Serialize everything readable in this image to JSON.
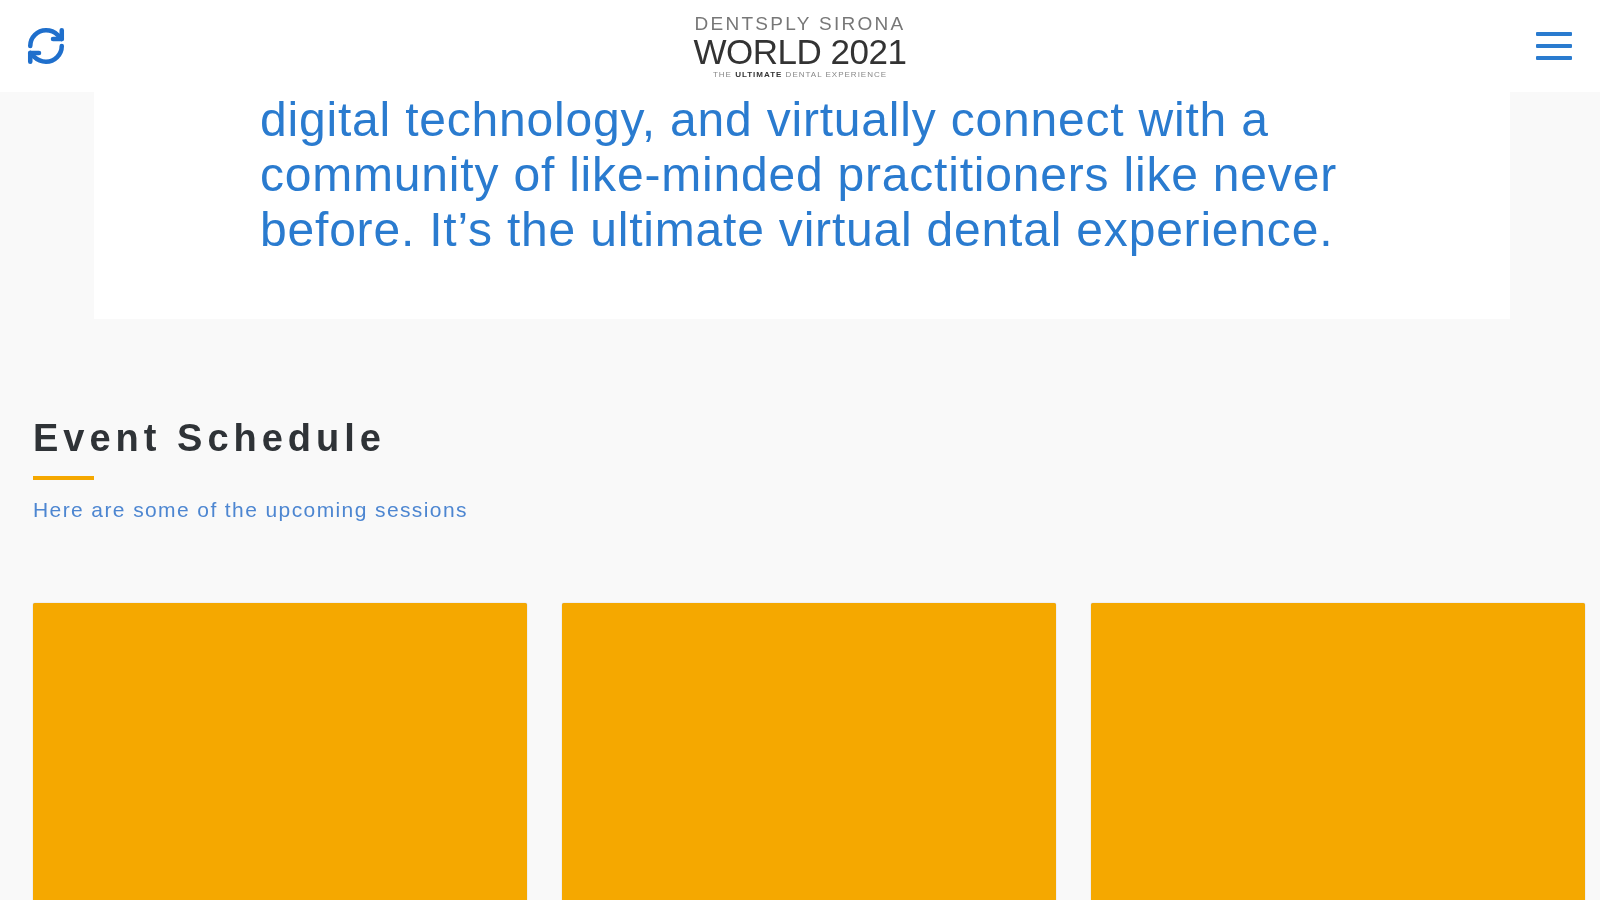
{
  "header": {
    "logo": {
      "brand": "DENTSPLY SIRONA",
      "event": "WORLD 2021",
      "tagline": "THE **ULTIMATE** DENTAL EXPERIENCE"
    }
  },
  "intro": {
    "text": "digital technology, and virtually connect with a community of like-minded practitioners like never before. It’s the ultimate virtual dental experience."
  },
  "schedule": {
    "title": "Event Schedule",
    "subtitle": "Here are some of the upcoming sessions",
    "cards": [
      {
        "kind": "session"
      },
      {
        "kind": "session"
      },
      {
        "kind": "session"
      }
    ]
  }
}
